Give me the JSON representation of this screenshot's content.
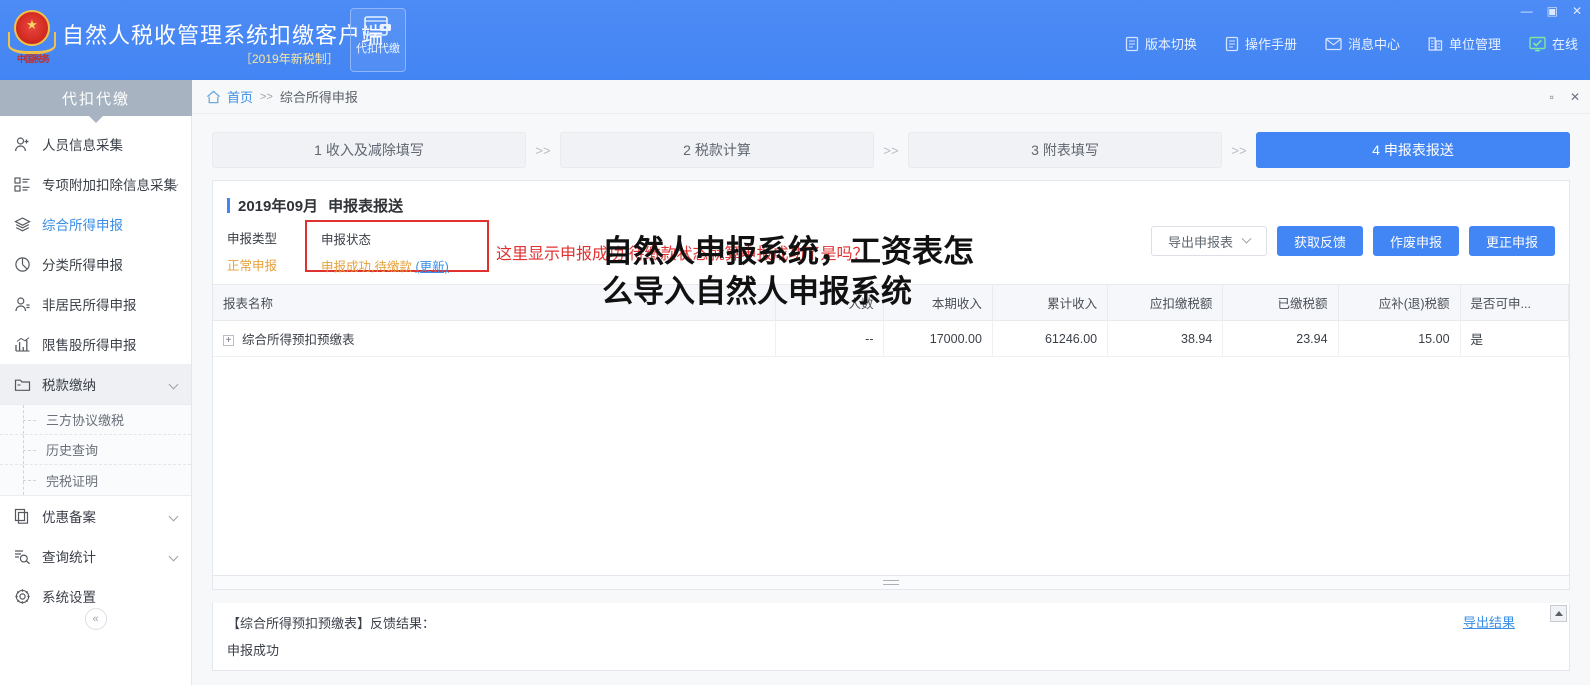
{
  "titlebar": {
    "app_title": "自然人税收管理系统扣缴客户端",
    "subtitle": "［2019年新税制］",
    "mode_label": "代扣代缴",
    "emblem_text": "中国税务",
    "menu": [
      {
        "label": "版本切换",
        "icon": "document-icon"
      },
      {
        "label": "操作手册",
        "icon": "document-icon"
      },
      {
        "label": "消息中心",
        "icon": "envelope-icon"
      },
      {
        "label": "单位管理",
        "icon": "building-icon"
      },
      {
        "label": "在线",
        "icon": "monitor-check-icon"
      }
    ],
    "window_controls": {
      "minimize": "—",
      "maximize": "▣",
      "close": "✕"
    }
  },
  "sidebar": {
    "header": "代扣代缴",
    "items": [
      {
        "label": "人员信息采集",
        "icon": "user-add-icon",
        "caret": false,
        "active": false
      },
      {
        "label": "专项附加扣除信息采集",
        "icon": "list-icon",
        "caret": true,
        "active": false
      },
      {
        "label": "综合所得申报",
        "icon": "layers-icon",
        "caret": false,
        "active": true
      },
      {
        "label": "分类所得申报",
        "icon": "pie-chart-icon",
        "caret": false,
        "active": false
      },
      {
        "label": "非居民所得申报",
        "icon": "user-icon",
        "caret": false,
        "active": false
      },
      {
        "label": "限售股所得申报",
        "icon": "bar-chart-icon",
        "caret": false,
        "active": false
      },
      {
        "label": "税款缴纳",
        "icon": "folder-icon",
        "caret": true,
        "active": false,
        "open": true
      },
      {
        "label": "优惠备案",
        "icon": "copy-icon",
        "caret": true,
        "active": false
      },
      {
        "label": "查询统计",
        "icon": "search-list-icon",
        "caret": true,
        "active": false
      },
      {
        "label": "系统设置",
        "icon": "gear-icon",
        "caret": false,
        "active": false
      }
    ],
    "submenu": [
      "三方协议缴税",
      "历史查询",
      "完税证明"
    ],
    "collapse_icon": "«"
  },
  "breadcrumb": {
    "home_icon": "home-icon",
    "home": "首页",
    "separator": ">>",
    "current": "综合所得申报",
    "restore_icon": "▫",
    "close_icon": "✕"
  },
  "steps": {
    "separator": ">>",
    "items": [
      {
        "label": "1 收入及减除填写",
        "done": false
      },
      {
        "label": "2 税款计算",
        "done": false
      },
      {
        "label": "3 附表填写",
        "done": false
      },
      {
        "label": "4 申报表报送",
        "done": true
      }
    ]
  },
  "panel": {
    "period": "2019年09月",
    "title": "申报表报送",
    "declare_type_label": "申报类型",
    "declare_type_value": "正常申报",
    "declare_state_label": "申报状态",
    "declare_state_value": "申报成功,待缴款",
    "declare_state_refresh": "(更新)",
    "annotation": "这里显示申报成功,待缴款状态就算申报成功了是吗？",
    "buttons": {
      "export": "导出申报表",
      "feedback": "获取反馈",
      "void": "作废申报",
      "correct": "更正申报"
    }
  },
  "table": {
    "columns": [
      {
        "label": "报表名称",
        "align": "left",
        "width": "40%"
      },
      {
        "label": "人数",
        "align": "right",
        "width": "9%"
      },
      {
        "label": "本期收入",
        "align": "right",
        "width": "9%"
      },
      {
        "label": "累计收入",
        "align": "right",
        "width": "9%"
      },
      {
        "label": "应扣缴税额",
        "align": "right",
        "width": "9%"
      },
      {
        "label": "已缴税额",
        "align": "right",
        "width": "9%"
      },
      {
        "label": "应补(退)税额",
        "align": "right",
        "width": "9%"
      },
      {
        "label": "是否可申...",
        "align": "left",
        "width": "6%"
      }
    ],
    "rows": [
      {
        "name": "综合所得预扣预缴表",
        "people": "--",
        "current_income": "17000.00",
        "total_income": "61246.00",
        "tax_payable": "38.94",
        "tax_paid": "23.94",
        "tax_diff": "15.00",
        "can_declare": "是"
      }
    ]
  },
  "feedback": {
    "title": "【综合所得预扣预缴表】反馈结果：",
    "result": "申报成功",
    "export_link": "导出结果"
  },
  "overlay": {
    "text": "自然人申报系统，工资表怎么导入自然人申报系统"
  },
  "colors": {
    "brand_blue": "#4285f4",
    "link_blue": "#3a8ee6",
    "warning_orange": "#e6a23c",
    "annotation_red": "#e03131",
    "success_green": "#6ec07a"
  }
}
